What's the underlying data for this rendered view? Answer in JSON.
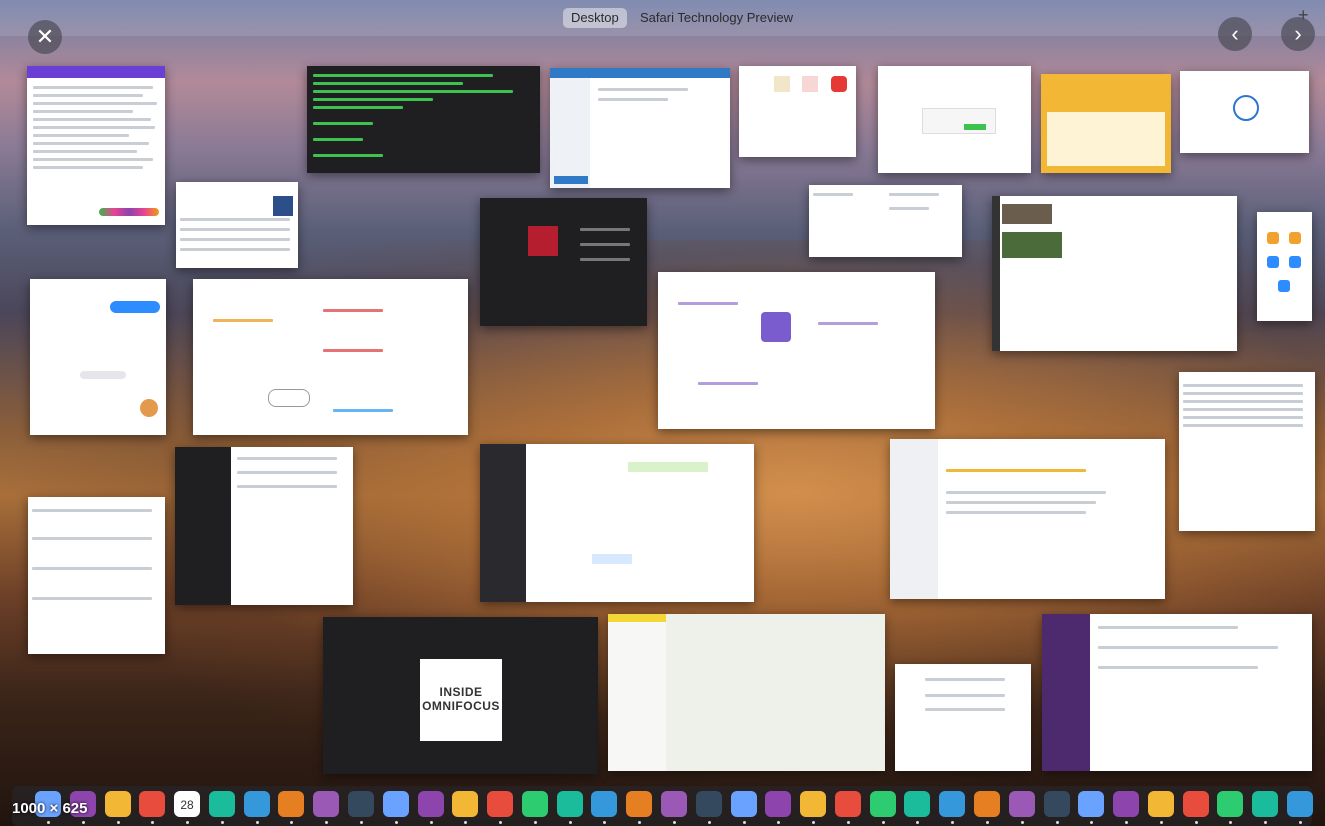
{
  "mission_control": {
    "tabs": [
      "Desktop",
      "Safari Technology Preview"
    ],
    "active_tab": 0,
    "close_icon": "close-icon",
    "prev_icon": "chevron-left-icon",
    "next_icon": "chevron-right-icon",
    "add_icon": "plus-icon"
  },
  "overlay": {
    "size_label": "1000 × 625"
  },
  "windows": {
    "omnifocus_splash": "INSIDE\nOMNIFOCUS",
    "map_title": "",
    "calendar_title": ""
  },
  "colors": {
    "purple_app": "#6b3fd6",
    "accent_orange": "#f2b734",
    "dock_bg": "#2f2f35"
  },
  "dock": {
    "icons": [
      "finder-icon",
      "launchpad-icon",
      "safari-icon",
      "clock-icon",
      "calendar-icon",
      "omnifocus-icon",
      "messages-icon",
      "trello-icon",
      "scrivener-icon",
      "opus-icon",
      "boxes-icon",
      "firefox-icon",
      "terminal-icon",
      "tweetbot-icon",
      "sketch-icon",
      "photos-icon",
      "notes-icon",
      "home-icon",
      "infuse-icon",
      "sonos-icon",
      "tapbots-icon",
      "preview-icon",
      "todo-icon",
      "pages-icon",
      "books-icon",
      "teamviewer-icon",
      "transmit-icon",
      "vpn-icon",
      "skype-icon",
      "mindnode-icon",
      "sourcetree-icon",
      "zoom-icon",
      "settings-icon",
      "1password-icon",
      "preview2-icon",
      "downloads-icon",
      "trash-icon"
    ],
    "calendar_day": "28"
  }
}
